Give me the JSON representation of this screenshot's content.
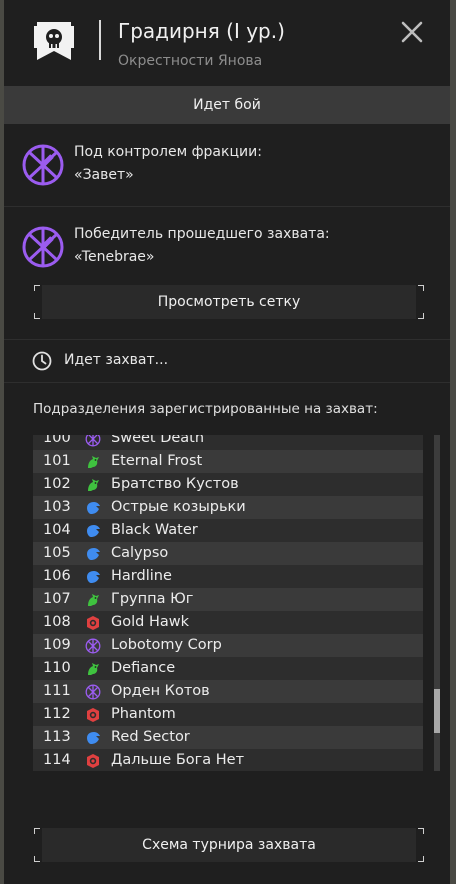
{
  "header": {
    "title": "Градирня (I ур.)",
    "subtitle": "Окрестности Янова",
    "emblem_icon": "skull-banner-icon",
    "close_icon": "close-icon"
  },
  "status_banner": "Идет бой",
  "control": {
    "label": "Под контролем фракции:",
    "faction": "«Завет»",
    "icon": "covenant-faction-icon"
  },
  "last_winner": {
    "label": "Победитель прошедшего захвата:",
    "faction": "«Tenebrae»",
    "icon": "covenant-faction-icon"
  },
  "view_grid_button": "Просмотреть сетку",
  "capture_status": {
    "text": "Идет захват...",
    "icon": "clock-icon"
  },
  "units_title": "Подразделения зарегистрированные на захват:",
  "units": [
    {
      "num": "100",
      "name": "Sweet Death",
      "faction": "covenant"
    },
    {
      "num": "101",
      "name": "Eternal Frost",
      "faction": "green"
    },
    {
      "num": "102",
      "name": "Братство Кустов",
      "faction": "green"
    },
    {
      "num": "103",
      "name": "Острые козырьки",
      "faction": "blue"
    },
    {
      "num": "104",
      "name": "Black Water",
      "faction": "blue"
    },
    {
      "num": "105",
      "name": "Calypso",
      "faction": "blue"
    },
    {
      "num": "106",
      "name": "Hardline",
      "faction": "blue"
    },
    {
      "num": "107",
      "name": "Группа Юг",
      "faction": "green"
    },
    {
      "num": "108",
      "name": "Gold Hawk",
      "faction": "red"
    },
    {
      "num": "109",
      "name": "Lobotomy Corp",
      "faction": "covenant"
    },
    {
      "num": "110",
      "name": "Defiance",
      "faction": "green"
    },
    {
      "num": "111",
      "name": "Орден Котов",
      "faction": "covenant"
    },
    {
      "num": "112",
      "name": "Phantom",
      "faction": "red"
    },
    {
      "num": "113",
      "name": "Red Sector",
      "faction": "blue"
    },
    {
      "num": "114",
      "name": "Дальше Бога Нет",
      "faction": "red"
    }
  ],
  "faction_colors": {
    "covenant": "#9b5cf0",
    "green": "#3fc23f",
    "blue": "#3f8cf0",
    "red": "#e04040"
  },
  "scroll_position": 0.87,
  "tournament_button": "Схема турнира захвата"
}
